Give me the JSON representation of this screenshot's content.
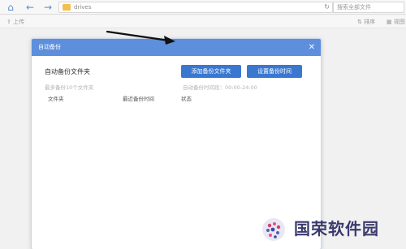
{
  "topbar": {
    "address_path": "drives",
    "search_placeholder": "搜索全部文件"
  },
  "toolbar": {
    "upload_label": "上传",
    "sort_label": "排序",
    "view_label": "视图"
  },
  "modal": {
    "title": "自动备份",
    "close_icon": "✕",
    "section_title": "自动备份文件夹",
    "add_button": "添加备份文件夹",
    "time_button": "设置备份时间",
    "hint_left": "最多备份10个文件夹",
    "hint_right": "自动备份时间段：00:00-24:00",
    "columns": [
      "文件夹",
      "最近备份时间",
      "状态"
    ]
  },
  "watermark": {
    "text": "国荣软件园"
  },
  "colors": {
    "header": "#5d8fdc",
    "button": "#3a78d0",
    "watermark_text": "#3b3b6d"
  }
}
